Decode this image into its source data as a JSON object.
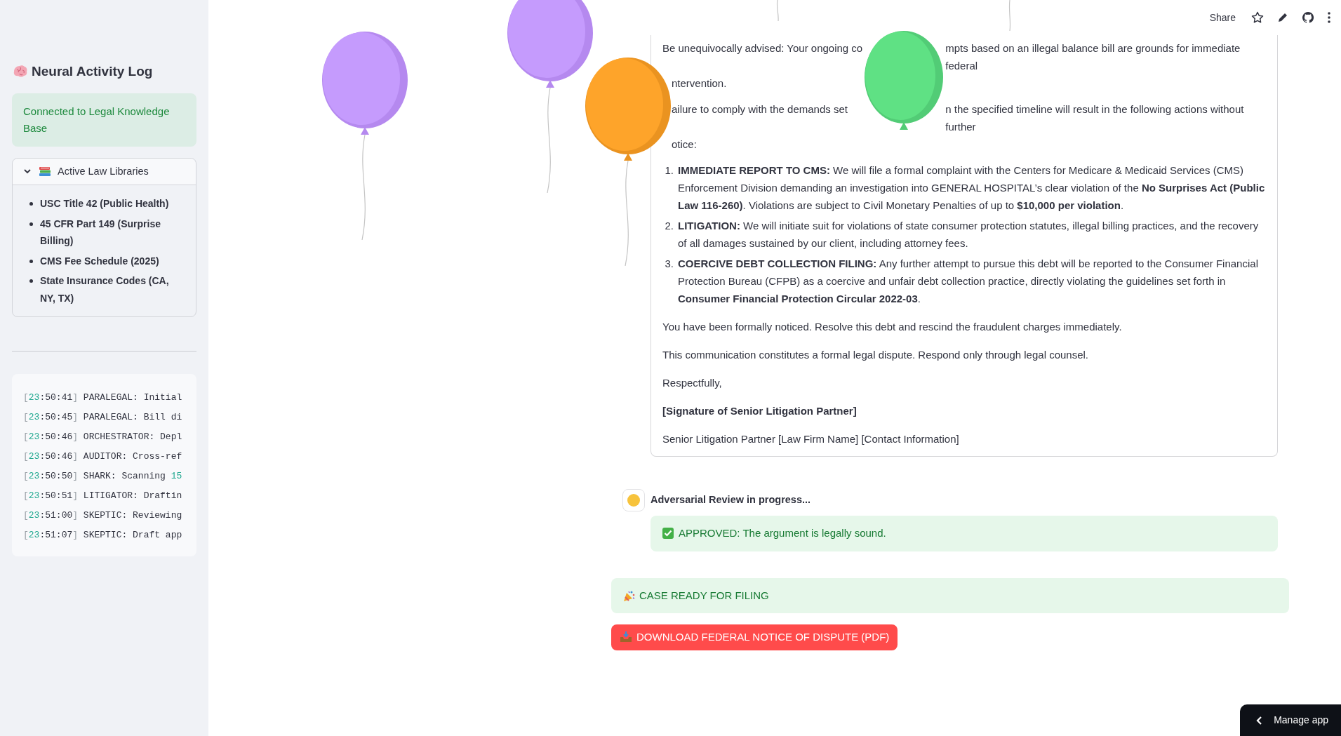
{
  "sidebar": {
    "title": "Neural Activity Log",
    "status": "Connected to Legal Knowledge Base",
    "expander": {
      "title": "Active Law Libraries",
      "expanded": true,
      "items": [
        "USC Title 42 (Public Health)",
        "45 CFR Part 149 (Surprise Billing)",
        "CMS Fee Schedule (2025)",
        "State Insurance Codes (CA, NY, TX)"
      ]
    },
    "log": [
      {
        "time": "[23:50:41]",
        "text": "PARALEGAL: Initial"
      },
      {
        "time": "[23:50:45]",
        "text": "PARALEGAL: Bill di"
      },
      {
        "time": "[23:50:46]",
        "text": "ORCHESTRATOR: Depl"
      },
      {
        "time": "[23:50:46]",
        "text": "AUDITOR: Cross-ref"
      },
      {
        "time": "[23:50:50]",
        "text": "SHARK: Scanning",
        "number": "15"
      },
      {
        "time": "[23:50:51]",
        "text": "LITIGATOR: Draftin"
      },
      {
        "time": "[23:51:00]",
        "text": "SKEPTIC: Reviewing"
      },
      {
        "time": "[23:51:07]",
        "text": "SKEPTIC: Draft app"
      }
    ]
  },
  "toolbar": {
    "share": "Share"
  },
  "letter": {
    "obscured_paragraphs": [
      [
        {
          "before": "Be unequivocally advised: Your ongoing co",
          "after": "mpts based on an illegal balance bill are grounds for immediate federal"
        },
        {
          "before": "ntervention.",
          "start_hidden": true
        }
      ],
      [
        {
          "before": "ailure to comply with the demands set",
          "after": "n the specified timeline will result in the following actions without further",
          "start_hidden": true
        },
        {
          "before": "otice:",
          "start_hidden": true
        }
      ]
    ],
    "items": [
      {
        "number": "1.",
        "text": "**IMMEDIATE REPORT TO CMS:** We will file a formal complaint with the Centers for Medicare & Medicaid Services (CMS) Enforcement Division demanding an investigation into GENERAL HOSPITAL’s clear violation of the **No Surprises Act (Public Law 116-260)**. Violations are subject to Civil Monetary Penalties of up to **$10,000 per violation**."
      },
      {
        "number": "2.",
        "text": "**LITIGATION:** We will initiate suit for violations of state consumer protection statutes, illegal billing practices, and the recovery of all damages sustained by our client, including attorney fees."
      },
      {
        "number": "3.",
        "text": "**COERCIVE DEBT COLLECTION FILING:** Any further attempt to pursue this debt will be reported to the Consumer Financial Protection Bureau (CFPB) as a coercive and unfair debt collection practice, directly violating the guidelines set forth in **Consumer Financial Protection Circular 2022-03**."
      }
    ],
    "paragraphs": [
      {
        "kind": "plain",
        "text": "You have been formally noticed. Resolve this debt and rescind the fraudulent charges immediately."
      },
      {
        "kind": "plain",
        "text": "This communication constitutes a formal legal dispute. Respond only through legal counsel."
      },
      {
        "kind": "plain",
        "text": "Respectfully,"
      },
      {
        "kind": "bold",
        "text": "[Signature of Senior Litigation Partner]"
      },
      {
        "kind": "plain",
        "text": "Senior Litigation Partner [Law Firm Name] [Contact Information]"
      }
    ]
  },
  "review": {
    "title": "Adversarial Review in progress...",
    "result": "APPROVED: The argument is legally sound."
  },
  "banner": "CASE READY FOR FILING",
  "download_button": "DOWNLOAD FEDERAL NOTICE OF DISPUTE (PDF)",
  "manage_app": "Manage app"
}
